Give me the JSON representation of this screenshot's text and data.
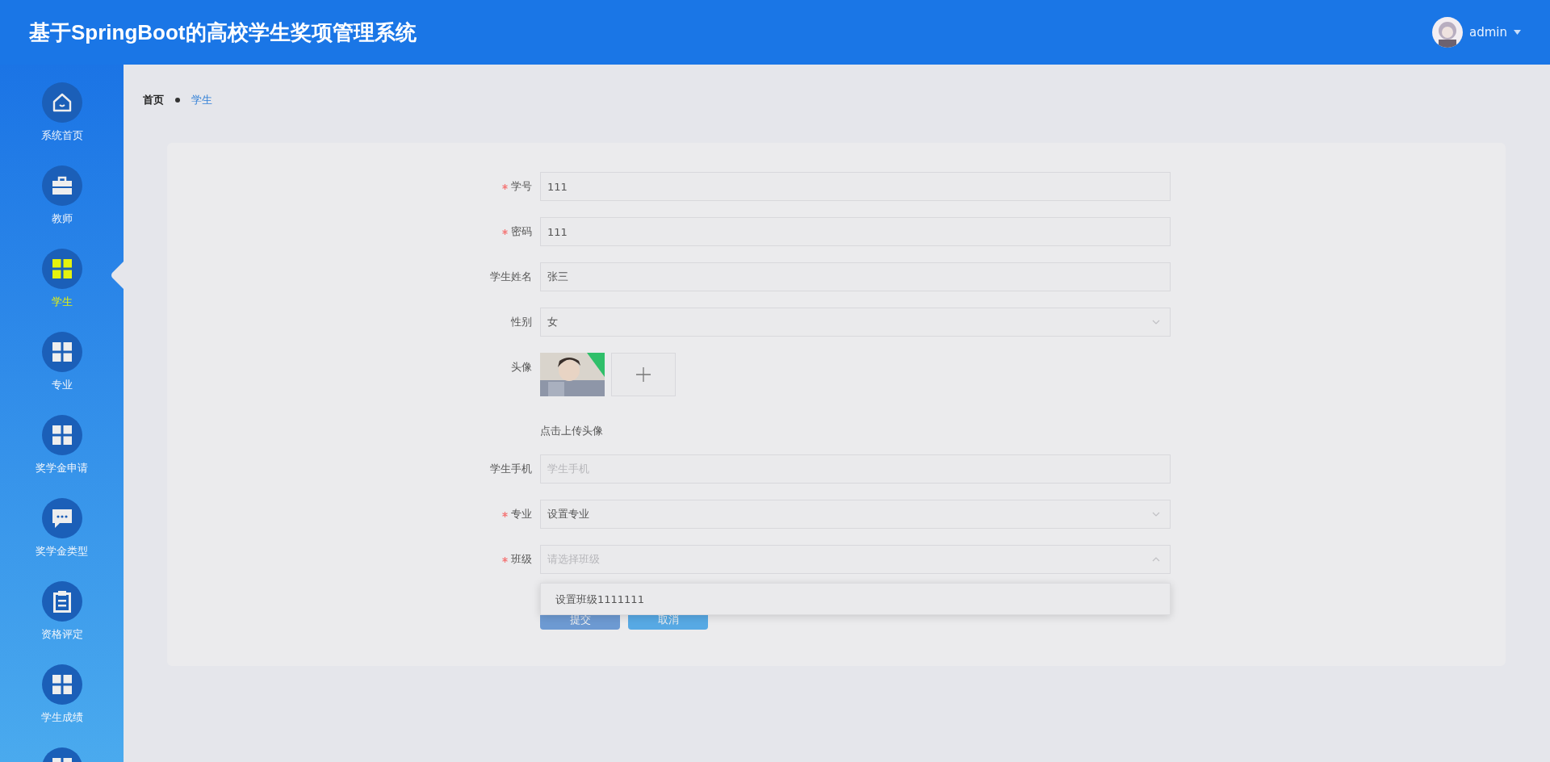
{
  "header": {
    "title": "基于SpringBoot的高校学生奖项管理系统",
    "user": "admin"
  },
  "sidebar": {
    "items": [
      {
        "label": "系统首页",
        "kind": "home",
        "selected": false
      },
      {
        "label": "教师",
        "kind": "briefcase",
        "selected": false
      },
      {
        "label": "学生",
        "kind": "grid",
        "selected": true
      },
      {
        "label": "专业",
        "kind": "grid",
        "selected": false
      },
      {
        "label": "奖学金申请",
        "kind": "grid",
        "selected": false
      },
      {
        "label": "奖学金类型",
        "kind": "chat",
        "selected": false
      },
      {
        "label": "资格评定",
        "kind": "clipboard",
        "selected": false
      },
      {
        "label": "学生成绩",
        "kind": "grid",
        "selected": false
      },
      {
        "kind": "grid",
        "selected": false
      }
    ]
  },
  "breadcrumb": [
    {
      "label": "首页",
      "current": false
    },
    {
      "label": "学生",
      "current": true
    }
  ],
  "form": {
    "fields": [
      {
        "kind": "text",
        "label": "学号",
        "required": true,
        "value": "111"
      },
      {
        "kind": "text",
        "label": "密码",
        "required": true,
        "value": "111"
      },
      {
        "kind": "text",
        "label": "学生姓名",
        "required": false,
        "value": "张三"
      },
      {
        "kind": "select",
        "label": "性别",
        "required": false,
        "value": "女",
        "open": false
      },
      {
        "kind": "upload",
        "label": "头像",
        "required": false,
        "hint": "点击上传头像"
      },
      {
        "kind": "text",
        "label": "学生手机",
        "required": false,
        "placeholder": "学生手机"
      },
      {
        "kind": "select",
        "label": "专业",
        "required": true,
        "value": "设置专业",
        "open": false
      },
      {
        "kind": "select",
        "label": "班级",
        "required": true,
        "placeholder": "请选择班级",
        "open": true,
        "options": [
          "设置班级1111111"
        ]
      }
    ],
    "buttons": [
      {
        "label": "提交",
        "kind": "primary"
      },
      {
        "label": "取消",
        "kind": "secondary"
      }
    ]
  }
}
